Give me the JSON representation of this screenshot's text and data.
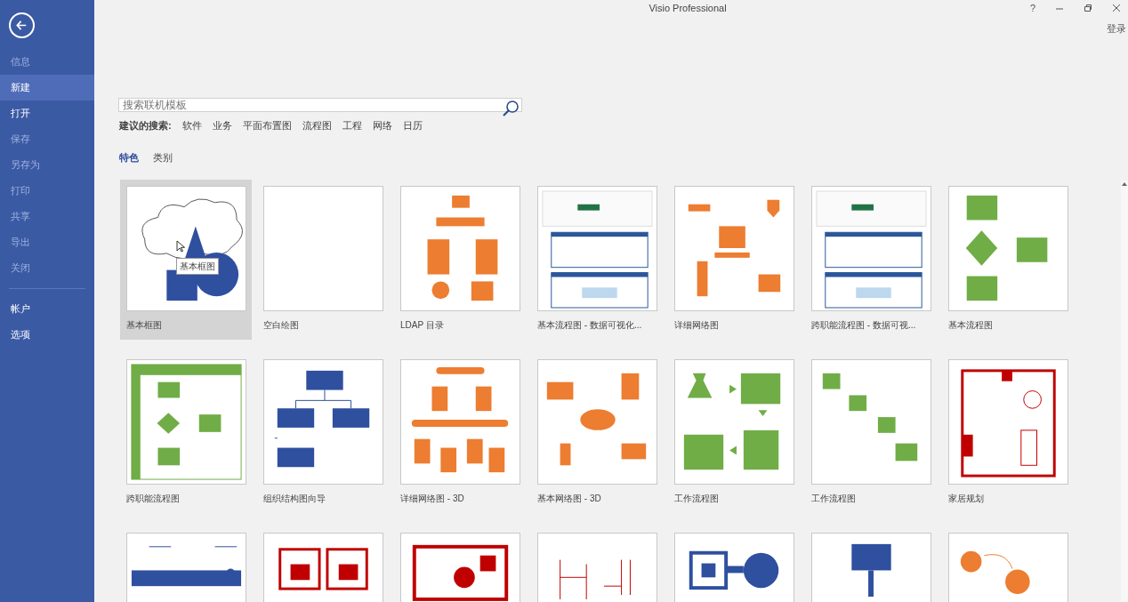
{
  "window": {
    "title": "Visio Professional",
    "help": "?",
    "sign_in": "登录"
  },
  "sidebar": {
    "items": [
      {
        "label": "信息",
        "selected": false,
        "disabled": true
      },
      {
        "label": "新建",
        "selected": true,
        "disabled": false
      },
      {
        "label": "打开",
        "selected": false,
        "disabled": false
      },
      {
        "label": "保存",
        "selected": false,
        "disabled": true
      },
      {
        "label": "另存为",
        "selected": false,
        "disabled": true
      },
      {
        "label": "打印",
        "selected": false,
        "disabled": true
      },
      {
        "label": "共享",
        "selected": false,
        "disabled": true
      },
      {
        "label": "导出",
        "selected": false,
        "disabled": true
      },
      {
        "label": "关闭",
        "selected": false,
        "disabled": true
      }
    ],
    "bottom_items": [
      {
        "label": "帐户",
        "selected": false,
        "disabled": false
      },
      {
        "label": "选项",
        "selected": false,
        "disabled": false
      }
    ]
  },
  "search": {
    "placeholder": "搜索联机模板"
  },
  "suggested": {
    "label": "建议的搜索:",
    "links": [
      "软件",
      "业务",
      "平面布置图",
      "流程图",
      "工程",
      "网络",
      "日历"
    ]
  },
  "tabs": [
    {
      "label": "特色",
      "selected": true
    },
    {
      "label": "类别",
      "selected": false
    }
  ],
  "templates": [
    {
      "kind": "shapes",
      "label": "基本框图",
      "selected": true,
      "tooltip": "基本框图"
    },
    {
      "kind": "blank",
      "label": "空白绘图",
      "selected": false
    },
    {
      "kind": "ldap",
      "label": "LDAP 目录",
      "selected": false
    },
    {
      "kind": "screens",
      "label": "基本流程图 - 数据可视化...",
      "selected": false
    },
    {
      "kind": "network",
      "label": "详细网络图",
      "selected": false
    },
    {
      "kind": "screens",
      "label": "跨职能流程图 - 数据可视...",
      "selected": false
    },
    {
      "kind": "flow",
      "label": "基本流程图",
      "selected": false
    },
    {
      "kind": "swimlane",
      "label": "跨职能流程图",
      "selected": false
    },
    {
      "kind": "org",
      "label": "组织结构图向导",
      "selected": false
    },
    {
      "kind": "servers",
      "label": "详细网络图 - 3D",
      "selected": false
    },
    {
      "kind": "star",
      "label": "基本网络图 - 3D",
      "selected": false
    },
    {
      "kind": "workflow",
      "label": "工作流程图",
      "selected": false
    },
    {
      "kind": "people",
      "label": "工作流程图",
      "selected": false
    },
    {
      "kind": "floor",
      "label": "家居规划",
      "selected": false
    },
    {
      "kind": "bus",
      "selected": false
    },
    {
      "kind": "rooms",
      "selected": false
    },
    {
      "kind": "office",
      "selected": false
    },
    {
      "kind": "circuit",
      "selected": false
    },
    {
      "kind": "blocks",
      "selected": false
    },
    {
      "kind": "sign",
      "selected": false
    },
    {
      "kind": "circles",
      "selected": false
    }
  ]
}
